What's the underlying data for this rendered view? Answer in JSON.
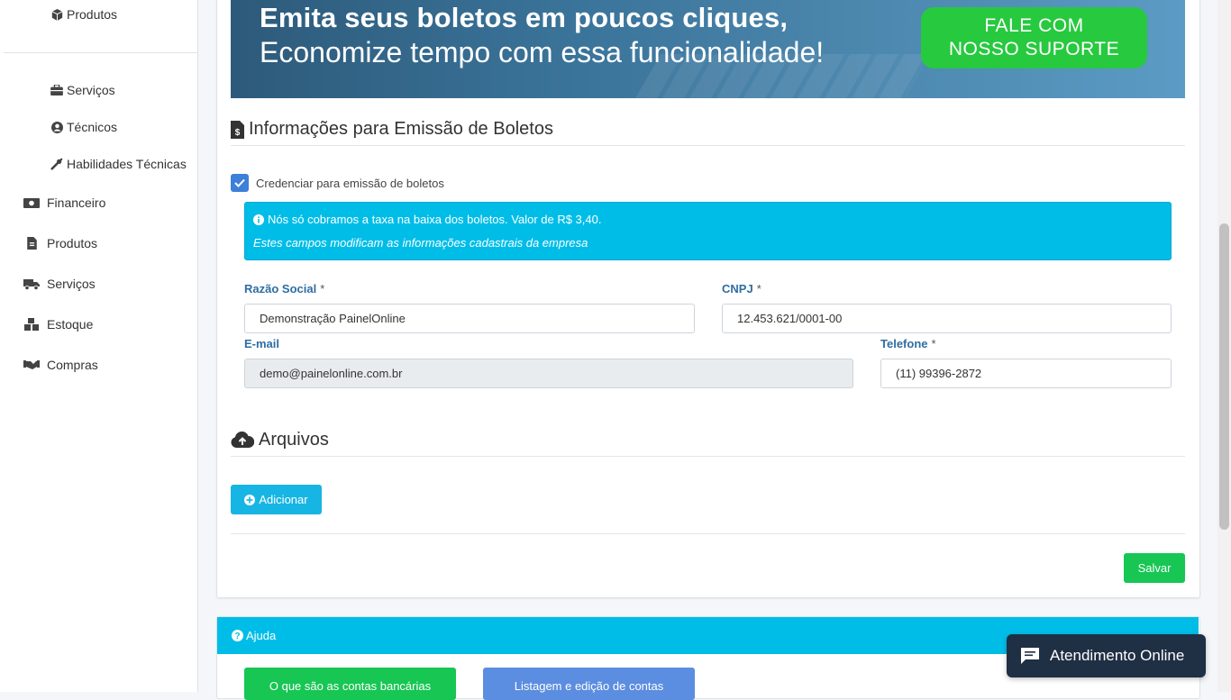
{
  "sidebar": {
    "sub_items": [
      {
        "label": "Produtos",
        "icon": "box-icon"
      },
      {
        "label": "Serviços",
        "icon": "briefcase-icon"
      },
      {
        "label": "Técnicos",
        "icon": "user-circle-icon"
      },
      {
        "label": "Habilidades Técnicas",
        "icon": "tools-icon"
      }
    ],
    "main_items": [
      {
        "label": "Financeiro",
        "icon": "money-bill-icon"
      },
      {
        "label": "Produtos",
        "icon": "file-invoice-icon"
      },
      {
        "label": "Serviços",
        "icon": "truck-icon"
      },
      {
        "label": "Estoque",
        "icon": "boxes-icon"
      },
      {
        "label": "Compras",
        "icon": "handshake-icon"
      }
    ]
  },
  "banner": {
    "headline": "Emita seus boletos em poucos cliques,",
    "subline": "Economize tempo com essa funcionalidade!",
    "cta_line1": "FALE COM",
    "cta_line2": "NOSSO SUPORTE"
  },
  "boleto_section": {
    "title": "Informações para Emissão de Boletos",
    "checkbox_label": "Credenciar para emissão de boletos",
    "checkbox_checked": true,
    "info_line1": "Nós só cobramos a taxa na baixa dos boletos. Valor de R$ 3,40.",
    "info_line2": "Estes campos modificam as informações cadastrais da empresa"
  },
  "form": {
    "razao_social_label": "Razão Social",
    "razao_social_value": "Demonstração PainelOnline",
    "cnpj_label": "CNPJ",
    "cnpj_value": "12.453.621/0001-00",
    "email_label": "E-mail",
    "email_value": "demo@painelonline.com.br",
    "telefone_label": "Telefone",
    "telefone_value": "(11) 99396-2872",
    "required_mark": "*"
  },
  "files_section": {
    "title": "Arquivos",
    "add_button": "Adicionar"
  },
  "save_button": "Salvar",
  "help": {
    "title": "Ajuda",
    "btn1": "O que são as contas bancárias",
    "btn2": "Listagem e edição de contas"
  },
  "chat": {
    "label": "Atendimento Online"
  },
  "colors": {
    "info": "#00bde8",
    "success": "#17c653",
    "primary": "#3d7fd9",
    "label_blue": "#2e6da4",
    "chat_bg": "#1f2f44"
  }
}
